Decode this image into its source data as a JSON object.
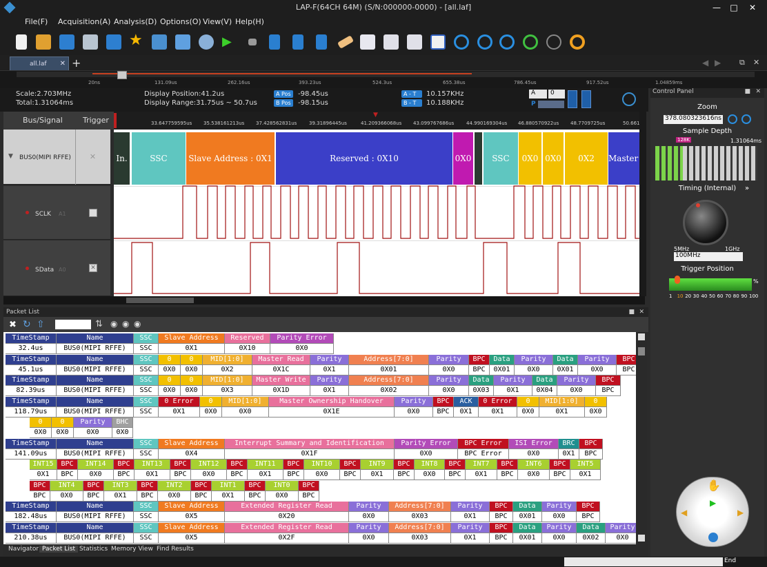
{
  "window": {
    "title": "LAP-F(64CH 64M) (S/N:000000-0000) - [all.laf]"
  },
  "menu": [
    "File(F)",
    "Acquisition(A)",
    "Analysis(D)",
    "Options(O)",
    "View(V)",
    "Help(H)"
  ],
  "tab": {
    "label": "all.laf"
  },
  "overview": {
    "ticks": [
      "20ns",
      "131.09us",
      "262.16us",
      "393.23us",
      "524.3us",
      "655.38us",
      "786.45us",
      "917.52us",
      "1.04859ms"
    ]
  },
  "info": {
    "scale": "Scale:2.703MHz",
    "total": "Total:1.31064ms",
    "display_position": "Display Position:41.2us",
    "display_range": "Display Range:31.75us ~ 50.7us",
    "a_pos_label": "A Pos",
    "a_pos": "-98.45us",
    "b_pos_label": "B Pos",
    "b_pos": "-98.15us",
    "at_label": "A - T",
    "at": "10.157KHz",
    "bt_label": "B - T",
    "bt": "10.188KHz",
    "sel_a": "A",
    "sel_0": "0",
    "p_label": "P"
  },
  "signals": {
    "header": "Bus/Signal",
    "trigger": "Trigger",
    "bus": "BUS0(MIPI RFFE)",
    "sclk": "SCLK",
    "sclk_ch": "A1",
    "sdata": "SData",
    "sdata_ch": "A0"
  },
  "ruler": [
    "33.647759595us",
    "35.538161213us",
    "37.428562831us",
    "39.31896445us",
    "41.209366068us",
    "43.099767686us",
    "44.990169304us",
    "46.880570922us",
    "48.7709725us",
    "50.661"
  ],
  "bus_segments": [
    {
      "text": "In.",
      "color": "#2a3a30"
    },
    {
      "text": "SSC",
      "color": "#5fc6c0"
    },
    {
      "text": "Slave Address : 0X1",
      "color": "#f07a20"
    },
    {
      "text": "Reserved : 0X10",
      "color": "#3b3fc8"
    },
    {
      "text": "0X0",
      "color": "#c01ab0"
    },
    {
      "text": "",
      "color": "#2a3a30"
    },
    {
      "text": "SSC",
      "color": "#5fc6c0"
    },
    {
      "text": "0X0",
      "color": "#f2c000"
    },
    {
      "text": "0X0",
      "color": "#f2c000"
    },
    {
      "text": "0X2",
      "color": "#f2c000"
    },
    {
      "text": "Master R",
      "color": "#3b3fc8"
    }
  ],
  "control_panel": {
    "title": "Control Panel",
    "zoom": "Zoom",
    "zoom_value": "378.080323616ns",
    "sample_depth": "Sample Depth",
    "depth_marker": "128K",
    "depth_total": "1.31064ms",
    "timing": "Timing (Internal)",
    "timing_min": "5MHz",
    "timing_max": "1GHz",
    "timing_value": "100MHz",
    "trigger_position": "Trigger Position",
    "trig_ticks": [
      "1",
      "10",
      "20",
      "30",
      "40",
      "50",
      "60",
      "70",
      "80",
      "90",
      "100"
    ],
    "percent": "%"
  },
  "packet_list": {
    "title": "Packet List"
  },
  "bottom_tabs": [
    "Navigator",
    "Packet List",
    "Statistics",
    "Memory View",
    "Find Results"
  ],
  "status": {
    "end": "End"
  },
  "colors": {
    "hdr_blue": "#2f3f8f",
    "ssc": "#5fc6c0",
    "orange": "#f07a20",
    "pink": "#e8709c",
    "violet": "#b24bb8",
    "yellow": "#f2c000",
    "mid": "#f0b030",
    "parity": "#8a6fd8",
    "bpc": "#c01020",
    "data": "#2aa080",
    "green": "#a8d030",
    "addr": "#f08050",
    "ack": "#2a5fa0",
    "gray": "#a0a0a0",
    "teal": "#1f8f8f"
  },
  "packets": [
    {
      "rows": [
        [
          [
            "TimeStamp",
            "hdr_blue",
            "32.4us",
            74
          ],
          [
            "Name",
            "hdr_blue",
            "BUS0(MIPI RFFE)",
            112
          ],
          [
            "SSC",
            "ssc",
            "SSC",
            36
          ],
          [
            "Slave Address",
            "orange",
            "0X1",
            96
          ],
          [
            "Reserved",
            "pink",
            "0X10",
            66
          ],
          [
            "Parity Error",
            "violet",
            "0X0",
            92
          ]
        ]
      ]
    },
    {
      "rows": [
        [
          [
            "TimeStamp",
            "hdr_blue",
            "45.1us",
            74
          ],
          [
            "Name",
            "hdr_blue",
            "BUS0(MIPI RFFE)",
            112
          ],
          [
            "SSC",
            "ssc",
            "SSC",
            36
          ],
          [
            "0",
            "yellow",
            "0X0",
            32
          ],
          [
            "0",
            "yellow",
            "0X0",
            32
          ],
          [
            "MID[1:0]",
            "mid",
            "0X2",
            72
          ],
          [
            "Master Read",
            "pink",
            "0X1C",
            84
          ],
          [
            "Parity",
            "parity",
            "0X1",
            56
          ],
          [
            "Address[7:0]",
            "addr",
            "0X01",
            116
          ],
          [
            "Parity",
            "parity",
            "0X0",
            58
          ],
          [
            "BPC",
            "bpc",
            "BPC",
            30
          ],
          [
            "Data",
            "data",
            "0X01",
            36
          ],
          [
            "Parity",
            "parity",
            "0X0",
            56
          ],
          [
            "Data",
            "data",
            "0X01",
            36
          ],
          [
            "Parity",
            "parity",
            "0X0",
            56
          ],
          [
            "BPC",
            "bpc",
            "BPC",
            36
          ]
        ]
      ]
    },
    {
      "rows": [
        [
          [
            "TimeStamp",
            "hdr_blue",
            "82.39us",
            74
          ],
          [
            "Name",
            "hdr_blue",
            "BUS0(MIPI RFFE)",
            112
          ],
          [
            "SSC",
            "ssc",
            "SSC",
            36
          ],
          [
            "0",
            "yellow",
            "0X0",
            32
          ],
          [
            "0",
            "yellow",
            "0X0",
            32
          ],
          [
            "MID[1:0]",
            "mid",
            "0X3",
            72
          ],
          [
            "Master Write",
            "pink",
            "0X1D",
            84
          ],
          [
            "Parity",
            "parity",
            "0X1",
            56
          ],
          [
            "Address[7:0]",
            "addr",
            "0X02",
            116
          ],
          [
            "Parity",
            "parity",
            "0X0",
            58
          ],
          [
            "Data",
            "data",
            "0X03",
            36
          ],
          [
            "Parity",
            "parity",
            "0X1",
            56
          ],
          [
            "Data",
            "data",
            "0X04",
            36
          ],
          [
            "Parity",
            "parity",
            "0X0",
            56
          ],
          [
            "BPC",
            "bpc",
            "BPC",
            36
          ]
        ]
      ]
    },
    {
      "rows": [
        [
          [
            "TimeStamp",
            "hdr_blue",
            "118.79us",
            74
          ],
          [
            "Name",
            "hdr_blue",
            "BUS0(MIPI RFFE)",
            112
          ],
          [
            "SSC",
            "ssc",
            "SSC",
            36
          ],
          [
            "0 Error",
            "bpc",
            "0X1",
            60
          ],
          [
            "0",
            "yellow",
            "0X0",
            32
          ],
          [
            "MID[1:0]",
            "mid",
            "0X0",
            68
          ],
          [
            "Master Ownership Handover",
            "pink",
            "0X1E",
            182
          ],
          [
            "Parity",
            "parity",
            "0X0",
            56
          ],
          [
            "BPC",
            "bpc",
            "BPC",
            30
          ],
          [
            "ACK",
            "ack",
            "0X1",
            36
          ],
          [
            "0 Error",
            "bpc",
            "0X1",
            56
          ],
          [
            "0",
            "yellow",
            "0X0",
            32
          ],
          [
            "MID[1:0]",
            "mid",
            "0X1",
            66
          ],
          [
            "0",
            "yellow",
            "0X0",
            32
          ]
        ],
        [
          [
            "0",
            "yellow",
            "0X0",
            32
          ],
          [
            "0",
            "yellow",
            "0X0",
            32
          ],
          [
            "Parity",
            "parity",
            "0X0",
            56
          ],
          [
            "BHC",
            "gray",
            "0X0",
            30
          ]
        ]
      ],
      "indent2": 38
    },
    {
      "rows": [
        [
          [
            "TimeStamp",
            "hdr_blue",
            "141.09us",
            74
          ],
          [
            "Name",
            "hdr_blue",
            "BUS0(MIPI RFFE)",
            112
          ],
          [
            "SSC",
            "ssc",
            "SSC",
            36
          ],
          [
            "Slave Address",
            "orange",
            "0X4",
            96
          ],
          [
            "Interrupt Summary and Identification",
            "pink",
            "0X1F",
            246
          ],
          [
            "Parity Error",
            "violet",
            "0X0",
            92
          ],
          [
            "BPC Error",
            "bpc",
            "BPC Error",
            74
          ],
          [
            "ISI Error",
            "violet",
            "0X0",
            72
          ],
          [
            "BRC",
            "teal",
            "0X1",
            30
          ],
          [
            "BPC",
            "bpc",
            "BPC",
            34
          ]
        ],
        [
          [
            "INT15",
            "green",
            "0X1",
            40
          ],
          [
            "BPC",
            "bpc",
            "BPC",
            30
          ],
          [
            "INT14",
            "green",
            "0X0",
            52
          ],
          [
            "BPC",
            "bpc",
            "BPC",
            30
          ],
          [
            "INT13",
            "green",
            "0X1",
            52
          ],
          [
            "BPC",
            "bpc",
            "BPC",
            30
          ],
          [
            "INT12",
            "green",
            "0X0",
            52
          ],
          [
            "BPC",
            "bpc",
            "BPC",
            30
          ],
          [
            "INT11",
            "green",
            "0X1",
            52
          ],
          [
            "BPC",
            "bpc",
            "BPC",
            30
          ],
          [
            "INT10",
            "green",
            "0X0",
            52
          ],
          [
            "BPC",
            "bpc",
            "BPC",
            30
          ],
          [
            "INT9",
            "green",
            "0X1",
            48
          ],
          [
            "BPC",
            "bpc",
            "BPC",
            30
          ],
          [
            "INT8",
            "green",
            "0X0",
            44
          ],
          [
            "BPC",
            "bpc",
            "BPC",
            30
          ],
          [
            "INT7",
            "green",
            "0X1",
            46
          ],
          [
            "BPC",
            "bpc",
            "BPC",
            30
          ],
          [
            "INT6",
            "green",
            "0X0",
            46
          ],
          [
            "BPC",
            "bpc",
            "BPC",
            30
          ],
          [
            "INT5",
            "green",
            "0X1",
            44
          ]
        ],
        [
          [
            "BPC",
            "bpc",
            "BPC",
            30
          ],
          [
            "INT4",
            "green",
            "0X0",
            48
          ],
          [
            "BPC",
            "bpc",
            "BPC",
            30
          ],
          [
            "INT3",
            "green",
            "0X1",
            48
          ],
          [
            "BPC",
            "bpc",
            "BPC",
            30
          ],
          [
            "INT2",
            "green",
            "0X0",
            48
          ],
          [
            "BPC",
            "bpc",
            "BPC",
            30
          ],
          [
            "INT1",
            "green",
            "0X1",
            48
          ],
          [
            "BPC",
            "bpc",
            "BPC",
            30
          ],
          [
            "INT0",
            "green",
            "0X0",
            48
          ],
          [
            "BPC",
            "bpc",
            "BPC",
            30
          ]
        ]
      ],
      "indent2": 38
    },
    {
      "rows": [
        [
          [
            "TimeStamp",
            "hdr_blue",
            "182.48us",
            74
          ],
          [
            "Name",
            "hdr_blue",
            "BUS0(MIPI RFFE)",
            112
          ],
          [
            "SSC",
            "ssc",
            "SSC",
            36
          ],
          [
            "Slave Address",
            "orange",
            "0X5",
            96
          ],
          [
            "Extended Register Read",
            "pink",
            "0X20",
            180
          ],
          [
            "Parity",
            "parity",
            "0X0",
            58
          ],
          [
            "Address[7:0]",
            "addr",
            "0X03",
            90
          ],
          [
            "Parity",
            "parity",
            "0X1",
            56
          ],
          [
            "BPC",
            "bpc",
            "BPC",
            34
          ],
          [
            "Data",
            "data",
            "0X01",
            42
          ],
          [
            "Parity",
            "parity",
            "0X0",
            50
          ],
          [
            "BPC",
            "bpc",
            "BPC",
            34
          ]
        ]
      ]
    },
    {
      "rows": [
        [
          [
            "TimeStamp",
            "hdr_blue",
            "210.38us",
            74
          ],
          [
            "Name",
            "hdr_blue",
            "BUS0(MIPI RFFE)",
            112
          ],
          [
            "SSC",
            "ssc",
            "SSC",
            36
          ],
          [
            "Slave Address",
            "orange",
            "0X5",
            96
          ],
          [
            "Extended Register Read",
            "pink",
            "0X2F",
            180
          ],
          [
            "Parity",
            "parity",
            "0X0",
            58
          ],
          [
            "Address[7:0]",
            "addr",
            "0X03",
            90
          ],
          [
            "Parity",
            "parity",
            "0X1",
            56
          ],
          [
            "BPC",
            "bpc",
            "BPC",
            34
          ],
          [
            "Data",
            "data",
            "0X01",
            42
          ],
          [
            "Parity",
            "parity",
            "0X0",
            50
          ],
          [
            "Data",
            "data",
            "0X02",
            42
          ],
          [
            "Parity",
            "parity",
            "0X0",
            50
          ]
        ]
      ]
    }
  ]
}
